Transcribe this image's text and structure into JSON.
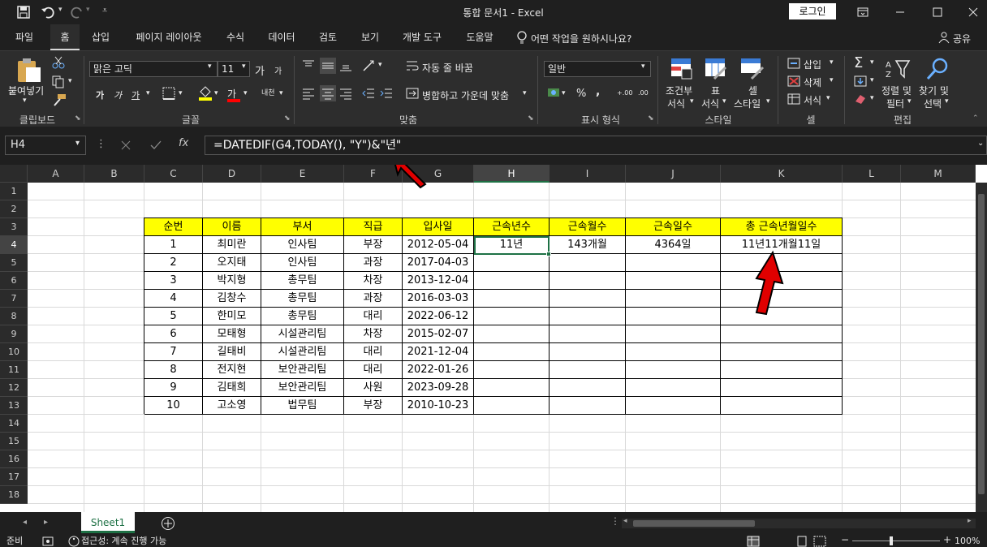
{
  "titlebar": {
    "doc_title": "통합 문서1  -  Excel",
    "login_label": "로그인"
  },
  "tabs": [
    {
      "label": "파일"
    },
    {
      "label": "홈"
    },
    {
      "label": "삽입"
    },
    {
      "label": "페이지 레이아웃"
    },
    {
      "label": "수식"
    },
    {
      "label": "데이터"
    },
    {
      "label": "검토"
    },
    {
      "label": "보기"
    },
    {
      "label": "개발 도구"
    },
    {
      "label": "도움말"
    }
  ],
  "tell_me": "어떤 작업을 원하시나요?",
  "share_label": "공유",
  "ribbon": {
    "paste_label": "붙여넣기",
    "clipboard_group": "클립보드",
    "font_name": "맑은 고딕",
    "font_size": "11",
    "font_group": "글꼴",
    "bold": "가",
    "italic": "가",
    "underline": "가",
    "font_color_glyph": "가",
    "phonetic_glyph": "내천",
    "grow_font": "가",
    "shrink_font": "가",
    "wrap_text": "자동 줄 바꿈",
    "merge_center": "병합하고 가운데 맞춤",
    "alignment_group": "맞춤",
    "number_format": "일반",
    "percent_label": "%",
    "comma_label": ",",
    "inc_decimal": "+.00",
    "dec_decimal": ".00",
    "number_group": "표시 형식",
    "cond_format_l1": "조건부",
    "cond_format_l2": "서식",
    "table_l1": "표",
    "table_l2": "서식",
    "cell_style_l1": "셀",
    "cell_style_l2": "스타일",
    "styles_group": "스타일",
    "insert_label": "삽입",
    "delete_label": "삭제",
    "format_label": "서식",
    "cells_group": "셀",
    "sort_l1": "정렬 및",
    "sort_l2": "필터",
    "find_l1": "찾기 및",
    "find_l2": "선택",
    "editing_group": "편집"
  },
  "formula_bar": {
    "name_box": "H4",
    "formula": "=DATEDIF(G4,TODAY(), \"Y\")&\"년\"",
    "fx_label": "fx"
  },
  "columns": [
    "A",
    "B",
    "C",
    "D",
    "E",
    "F",
    "G",
    "H",
    "I",
    "J",
    "K",
    "L",
    "M"
  ],
  "rows": [
    "1",
    "2",
    "3",
    "4",
    "5",
    "6",
    "7",
    "8",
    "9",
    "10",
    "11",
    "12",
    "13",
    "14",
    "15",
    "16",
    "17",
    "18"
  ],
  "table": {
    "headers": [
      "순번",
      "이름",
      "부서",
      "직급",
      "입사일",
      "근속년수",
      "근속월수",
      "근속일수",
      "총 근속년월일수"
    ],
    "rows": [
      [
        "1",
        "최미란",
        "인사팀",
        "부장",
        "2012-05-04",
        "11년",
        "143개월",
        "4364일",
        "11년11개월11일"
      ],
      [
        "2",
        "오지태",
        "인사팀",
        "과장",
        "2017-04-03",
        "",
        "",
        "",
        ""
      ],
      [
        "3",
        "박지형",
        "총무팀",
        "차장",
        "2013-12-04",
        "",
        "",
        "",
        ""
      ],
      [
        "4",
        "김창수",
        "총무팀",
        "과장",
        "2016-03-03",
        "",
        "",
        "",
        ""
      ],
      [
        "5",
        "한미모",
        "총무팀",
        "대리",
        "2022-06-12",
        "",
        "",
        "",
        ""
      ],
      [
        "6",
        "모태형",
        "시설관리팀",
        "차장",
        "2015-02-07",
        "",
        "",
        "",
        ""
      ],
      [
        "7",
        "길태비",
        "시설관리팀",
        "대리",
        "2021-12-04",
        "",
        "",
        "",
        ""
      ],
      [
        "8",
        "전지현",
        "보안관리팀",
        "대리",
        "2022-01-26",
        "",
        "",
        "",
        ""
      ],
      [
        "9",
        "김태희",
        "보안관리팀",
        "사원",
        "2023-09-28",
        "",
        "",
        "",
        ""
      ],
      [
        "10",
        "고소영",
        "법무팀",
        "부장",
        "2010-10-23",
        "",
        "",
        "",
        ""
      ]
    ]
  },
  "sheet_tab": "Sheet1",
  "status": {
    "ready": "준비",
    "accessibility": "접근성: 계속 진행 가능",
    "zoom": "100%"
  },
  "colors": {
    "header_fill": "#ffff00",
    "arrow": "#e00000",
    "selection": "#1e7145"
  }
}
